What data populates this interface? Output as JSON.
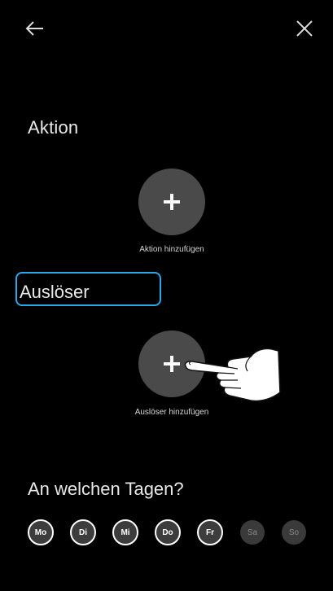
{
  "header": {
    "back_icon": "arrow-left-icon",
    "close_icon": "close-icon"
  },
  "action_section": {
    "title": "Aktion",
    "add_label": "Aktion hinzufügen",
    "add_icon": "plus-icon"
  },
  "trigger_section": {
    "title": "Auslöser",
    "add_label": "Auslöser hinzufügen",
    "add_icon": "plus-icon",
    "highlight_color": "#2aa7e8"
  },
  "days_section": {
    "title": "An welchen Tagen?",
    "days": [
      {
        "label": "Mo",
        "active": true
      },
      {
        "label": "Di",
        "active": true
      },
      {
        "label": "Mi",
        "active": true
      },
      {
        "label": "Do",
        "active": true
      },
      {
        "label": "Fr",
        "active": true
      },
      {
        "label": "Sa",
        "active": false
      },
      {
        "label": "So",
        "active": false
      }
    ]
  },
  "overlay": {
    "icon": "pointing-hand-icon"
  }
}
